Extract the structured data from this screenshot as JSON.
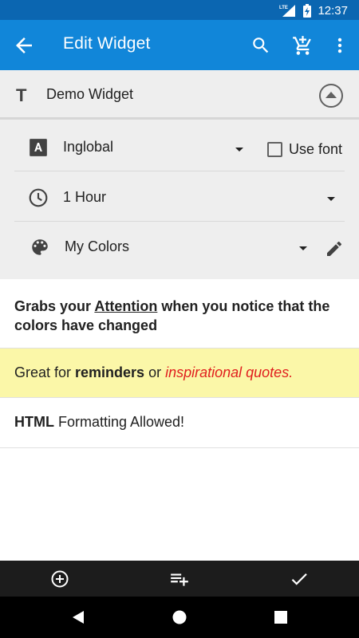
{
  "status_bar": {
    "time": "12:37",
    "network": "LTE"
  },
  "app_bar": {
    "title": "Edit Widget"
  },
  "widget": {
    "name": "Demo Widget",
    "font": {
      "value": "Inglobal",
      "use_font_label": "Use font",
      "use_font_checked": false
    },
    "interval": {
      "value": "1 Hour"
    },
    "colors": {
      "value": "My Colors"
    }
  },
  "preview": {
    "line1": {
      "before": "Grabs your ",
      "underlined": "Attention",
      "after": " when you notice that the colors have changed"
    },
    "line2": {
      "before": "Great for ",
      "bold": "reminders",
      "middle": " or ",
      "red": "inspirational quotes.",
      "bg": "#fbf7a8",
      "red_color": "#e01e1e"
    },
    "line3": {
      "bold": "HTML",
      "after": " Formatting Allowed!"
    }
  },
  "colors": {
    "status_bar": "#0b66b1",
    "app_bar": "#1186d9",
    "panel": "#eeeeee",
    "toolbar": "#1c1c1c"
  },
  "icons": {
    "app_bar": [
      "back-arrow-icon",
      "search-icon",
      "add-shopping-cart-icon",
      "more-vert-icon"
    ],
    "bottom_toolbar": [
      "add-circle-icon",
      "playlist-add-icon",
      "check-icon"
    ],
    "nav": [
      "back-triangle-icon",
      "home-circle-icon",
      "recents-square-icon"
    ]
  }
}
